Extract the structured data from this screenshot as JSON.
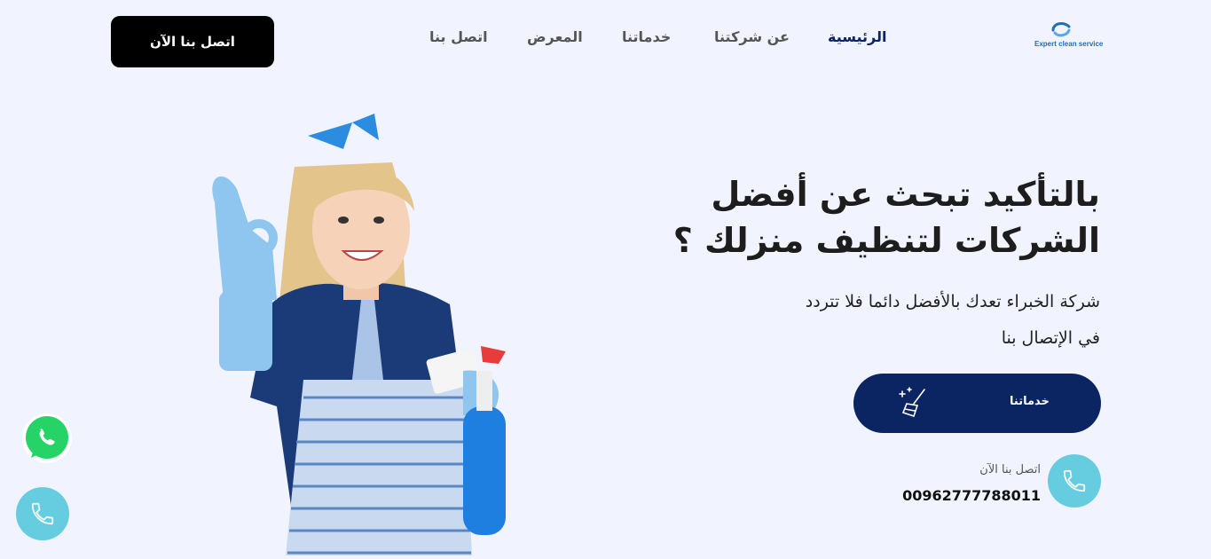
{
  "brand": {
    "logo_text": "Expert clean service",
    "colors": {
      "primary": "#0b2563",
      "accent": "#66cde0",
      "background": "#f1f3fe",
      "whatsapp": "#25d366"
    }
  },
  "nav": {
    "items": [
      {
        "label": "الرئيسية",
        "active": true
      },
      {
        "label": "عن شركتنا",
        "active": false
      },
      {
        "label": "خدماتنا",
        "active": false
      },
      {
        "label": "المعرض",
        "active": false
      },
      {
        "label": "اتصل بنا",
        "active": false
      }
    ],
    "cta_label": "اتصل بنا الآن"
  },
  "hero": {
    "headline_line1": "بالتأكيد تبحث عن أفضل",
    "headline_line2": "الشركات لتنظيف منزلك ؟",
    "subtext_line1": "شركة الخبراء تعدك بالأفضل دائما فلا تتردد",
    "subtext_line2": "في الإتصال بنا",
    "services_button": {
      "label": "خدماتنا",
      "icon": "cleaning-broom-icon"
    },
    "call": {
      "label": "اتصل بنا الآن",
      "number": "00962777788011",
      "icon": "phone-icon"
    }
  },
  "floating": {
    "whatsapp_icon": "whatsapp-icon",
    "phone_icon": "phone-icon"
  }
}
